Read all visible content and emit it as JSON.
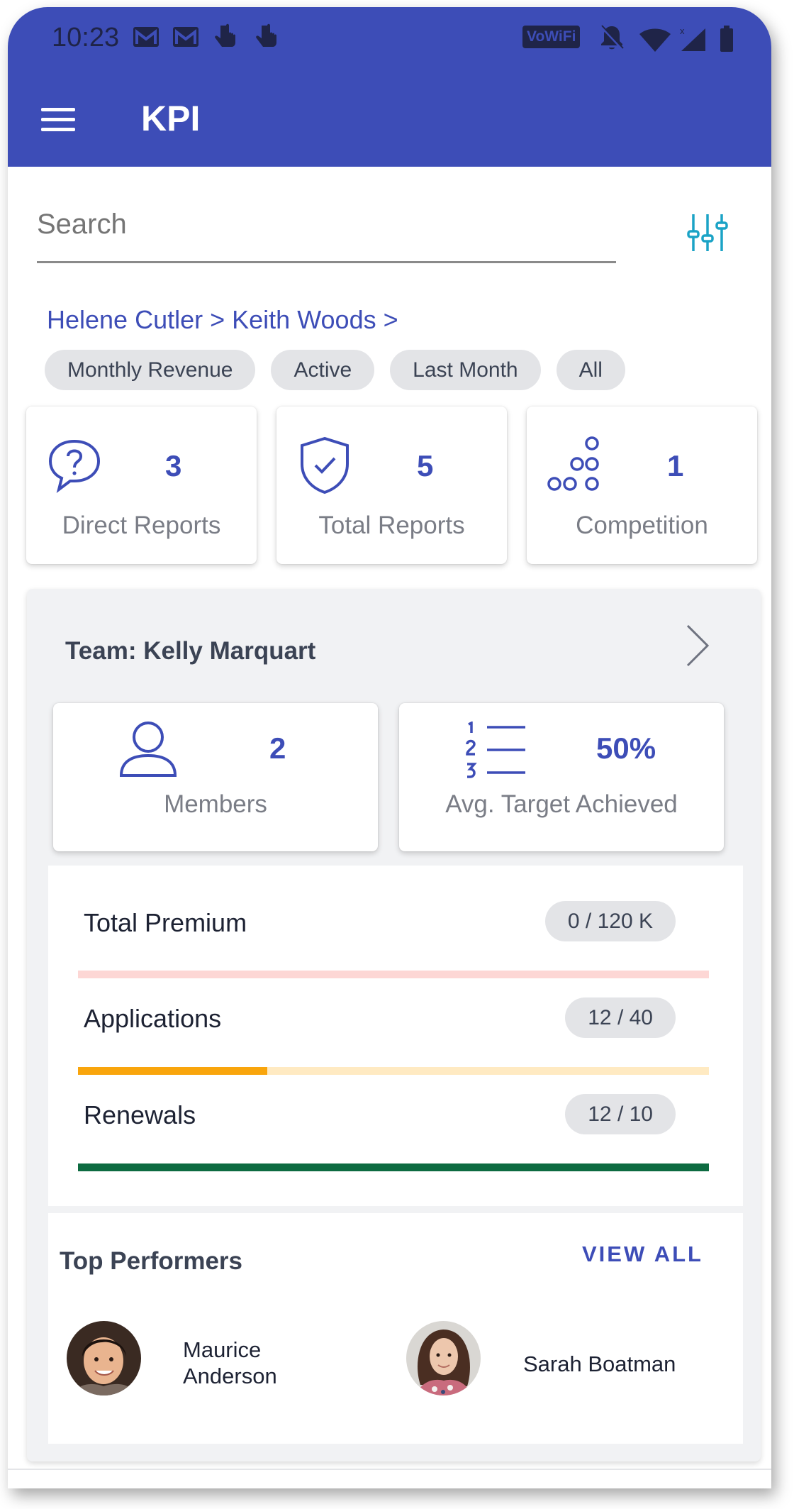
{
  "status_bar": {
    "time": "10:23",
    "wifi_badge": "VoWiFi"
  },
  "app_bar": {
    "title": "KPI",
    "menu_icon": "hamburger-menu-icon"
  },
  "search": {
    "placeholder": "Search",
    "filter_icon": "sliders-filter-icon"
  },
  "breadcrumb": "Helene Cutler > Keith Woods >",
  "filters": [
    "Monthly Revenue",
    "Active",
    "Last Month",
    "All"
  ],
  "stats": [
    {
      "icon": "question-bubble-icon",
      "value": "3",
      "label": "Direct Reports"
    },
    {
      "icon": "shield-check-icon",
      "value": "5",
      "label": "Total Reports"
    },
    {
      "icon": "circles-pyramid-icon",
      "value": "1",
      "label": "Competition"
    }
  ],
  "team": {
    "title": "Team: Kelly Marquart",
    "members": {
      "icon": "person-icon",
      "value": "2",
      "label": "Members"
    },
    "target": {
      "icon": "numbered-list-icon",
      "value": "50%",
      "label": "Avg. Target Achieved"
    }
  },
  "kpis": [
    {
      "label": "Total Premium",
      "badge": "0 / 120 K",
      "progress": 0,
      "track_color": "#fdd7d5",
      "fill_color": "#f28b82"
    },
    {
      "label": "Applications",
      "badge": "12 / 40",
      "progress": 0.3,
      "track_color": "#ffeac2",
      "fill_color": "#f9a50c"
    },
    {
      "label": "Renewals",
      "badge": "12 / 10",
      "progress": 1,
      "track_color": "#c8e6c9",
      "fill_color": "#0d6b41"
    }
  ],
  "top_performers": {
    "title": "Top Performers",
    "view_all": "VIEW ALL",
    "people": [
      {
        "name_line1": "Maurice",
        "name_line2": "Anderson"
      },
      {
        "name_line1": "Sarah Boatman",
        "name_line2": ""
      }
    ]
  },
  "colors": {
    "primary": "#3d4db7",
    "accent_teal": "#1ba3c6"
  }
}
